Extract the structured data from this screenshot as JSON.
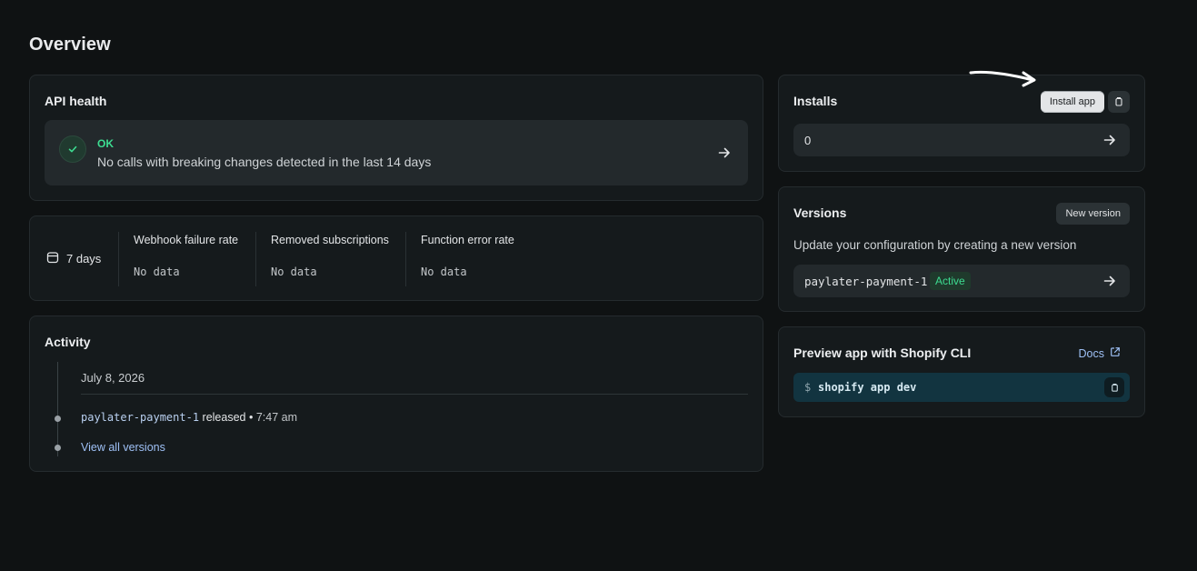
{
  "page": {
    "title": "Overview"
  },
  "api_health": {
    "title": "API health",
    "status": "OK",
    "description": "No calls with breaking changes detected in the last 14 days",
    "icons": {
      "status": "check-icon",
      "open": "arrow-right-icon"
    }
  },
  "metrics": {
    "range_label": "7 days",
    "items": [
      {
        "label": "Webhook failure rate",
        "value": "No data"
      },
      {
        "label": "Removed subscriptions",
        "value": "No data"
      },
      {
        "label": "Function error rate",
        "value": "No data"
      }
    ]
  },
  "activity": {
    "title": "Activity",
    "date": "July 8, 2026",
    "entry": {
      "version": "paylater-payment-1",
      "action": "released",
      "separator": "•",
      "time": "7:47 am"
    },
    "view_all_label": "View all versions"
  },
  "installs": {
    "title": "Installs",
    "install_button": "Install app",
    "count": "0"
  },
  "versions": {
    "title": "Versions",
    "new_button": "New version",
    "description": "Update your configuration by creating a new version",
    "current": {
      "name": "paylater-payment-1",
      "status": "Active"
    }
  },
  "preview": {
    "title": "Preview app with Shopify CLI",
    "docs_label": "Docs",
    "prompt": "$",
    "command": "shopify app dev"
  },
  "colors": {
    "background": "#0f1213",
    "card": "#151a1c",
    "success": "#3ddc91",
    "link": "#9ec0f5",
    "command_bg": "#123440"
  }
}
